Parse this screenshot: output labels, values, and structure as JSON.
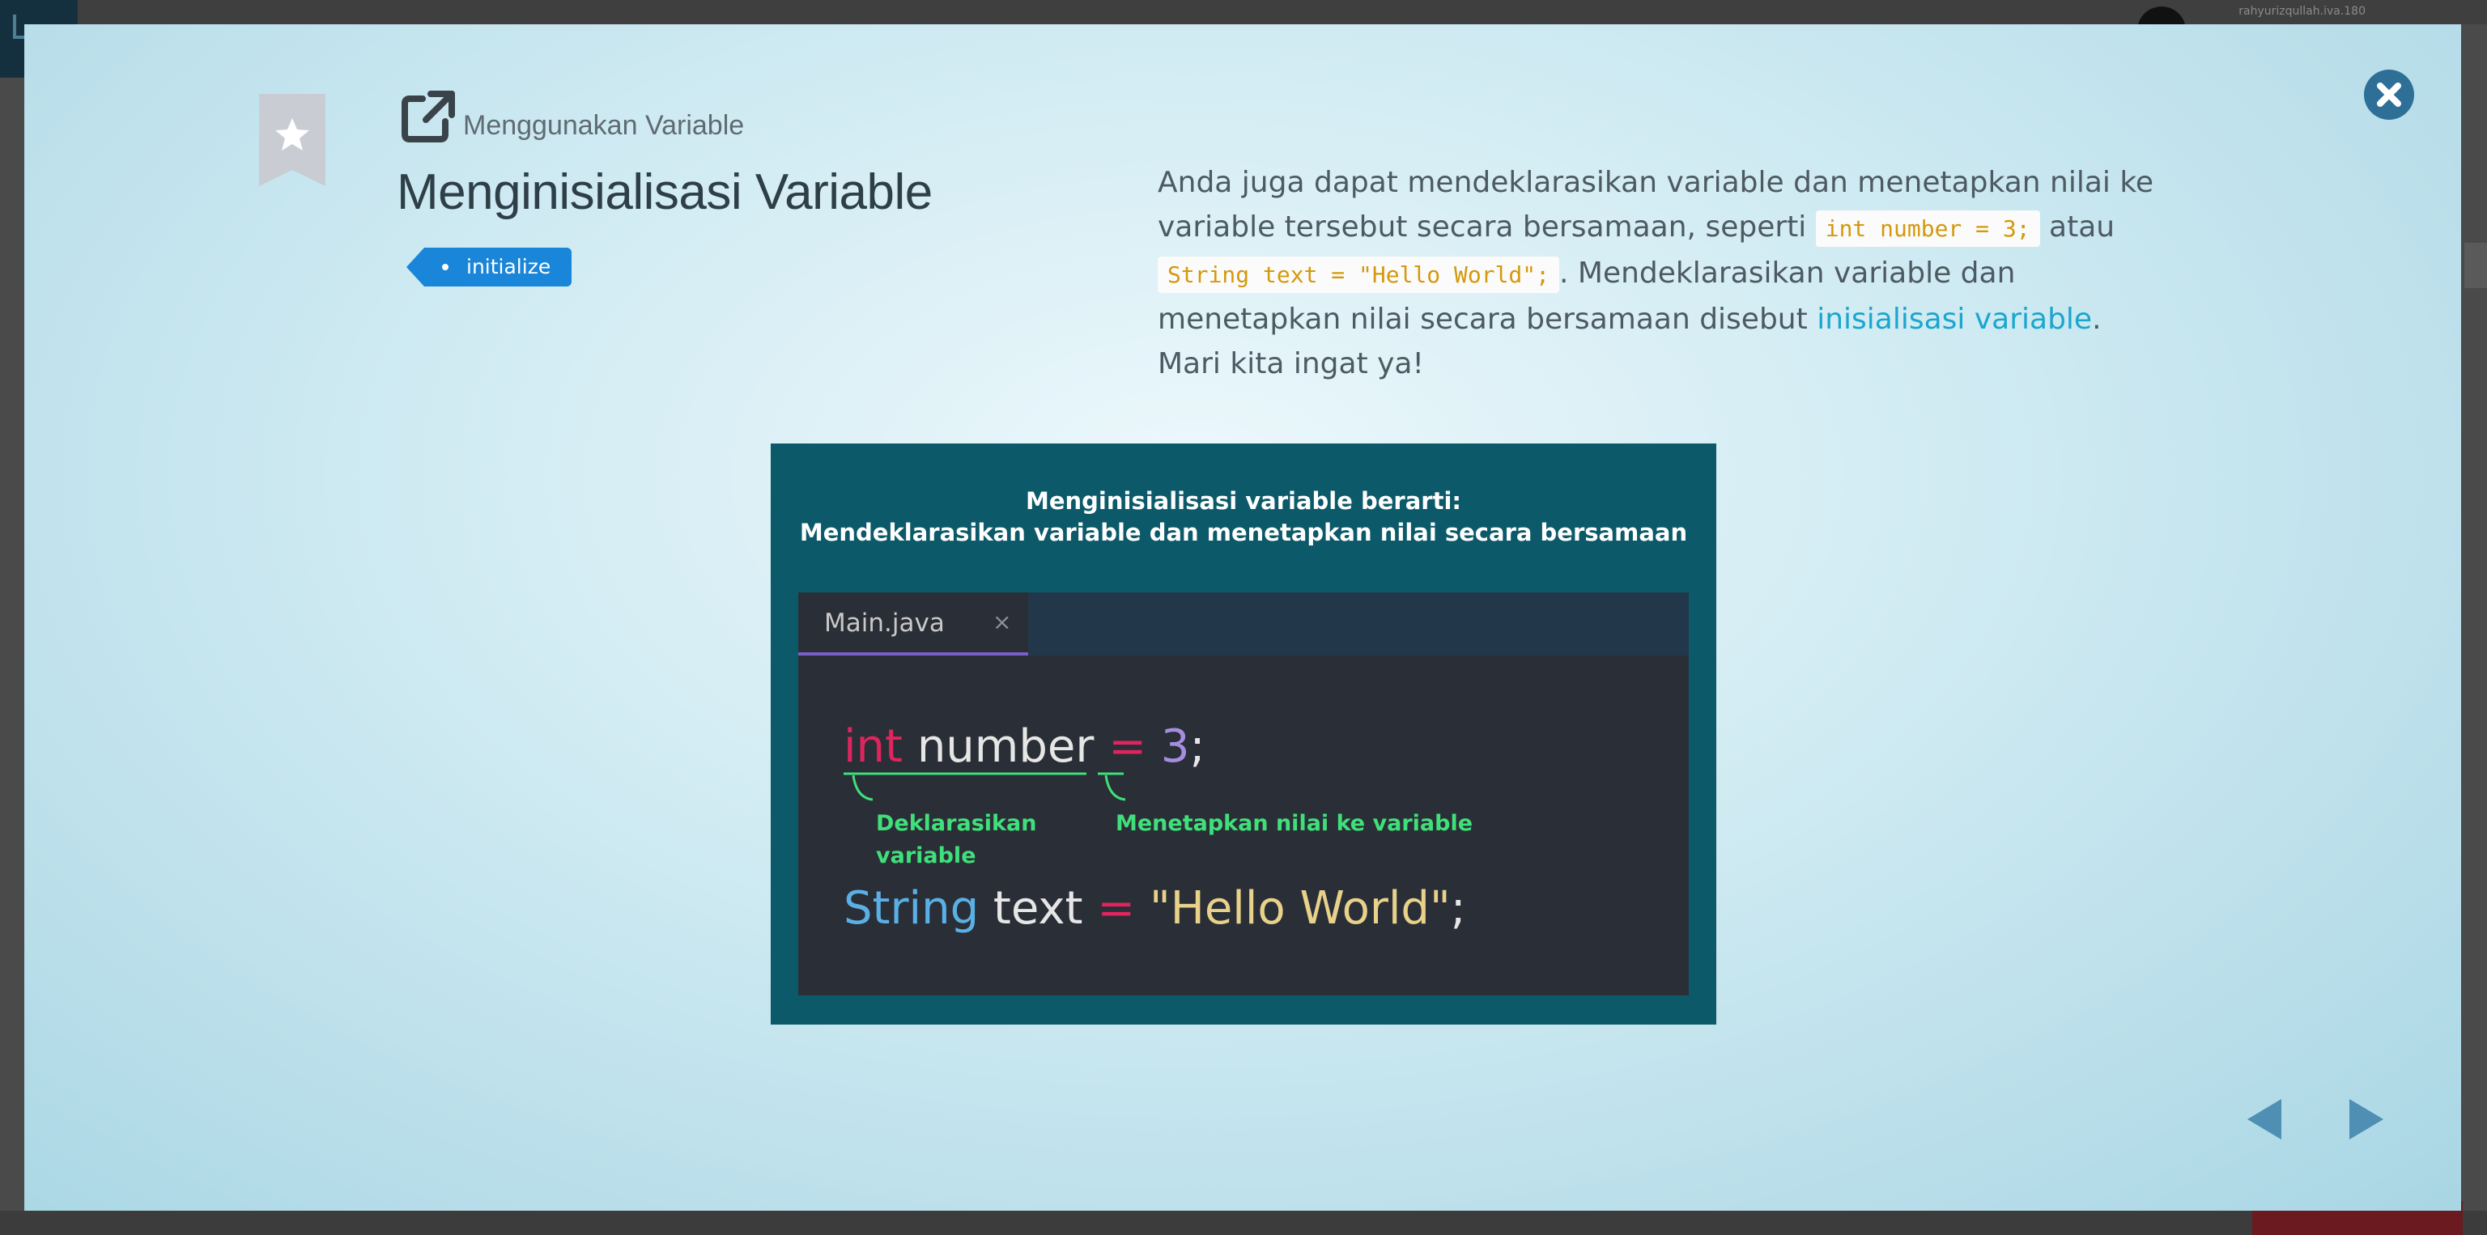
{
  "background": {
    "user_text": "rahyurizqullah.iva.180"
  },
  "modal": {
    "breadcrumb": "Menggunakan Variable",
    "title": "Menginisialisasi Variable",
    "tag": "initialize",
    "description": {
      "part1": "Anda juga dapat mendeklarasikan variable dan menetapkan nilai ke variable tersebut secara bersamaan, seperti ",
      "code1": "int number = 3;",
      "part2": " atau ",
      "code2": "String text = \"Hello World\";",
      "part3": ". Mendeklarasikan variable dan menetapkan nilai secara bersamaan disebut ",
      "link": "inisialisasi variable",
      "part4": ". Mari kita ingat ya!"
    },
    "figure": {
      "title_line1": "Menginisialisasi variable berarti:",
      "title_line2": "Mendeklarasikan variable dan menetapkan nilai secara bersamaan",
      "tab_label": "Main.java",
      "tab_close": "×",
      "line1": {
        "type": "int",
        "name": " number ",
        "equals": "=",
        "space": " ",
        "value": "3",
        "semicolon": ";"
      },
      "line2": {
        "type": "String",
        "name": " text ",
        "equals": "=",
        "value": " \"Hello World\"",
        "semicolon": ";"
      },
      "annotation1": "Deklarasikan variable",
      "annotation2": "Menetapkan nilai ke variable"
    }
  },
  "colors": {
    "tag": "#1a86d9",
    "link": "#1aa6cf",
    "code": "#d4990c",
    "keyword_red": "#e0245e",
    "keyword_blue": "#5ab0e6",
    "annotation_green": "#3fe07a"
  },
  "icons": [
    "bookmark-star-icon",
    "external-link-icon",
    "close-icon",
    "arrow-left-icon",
    "arrow-right-icon"
  ]
}
